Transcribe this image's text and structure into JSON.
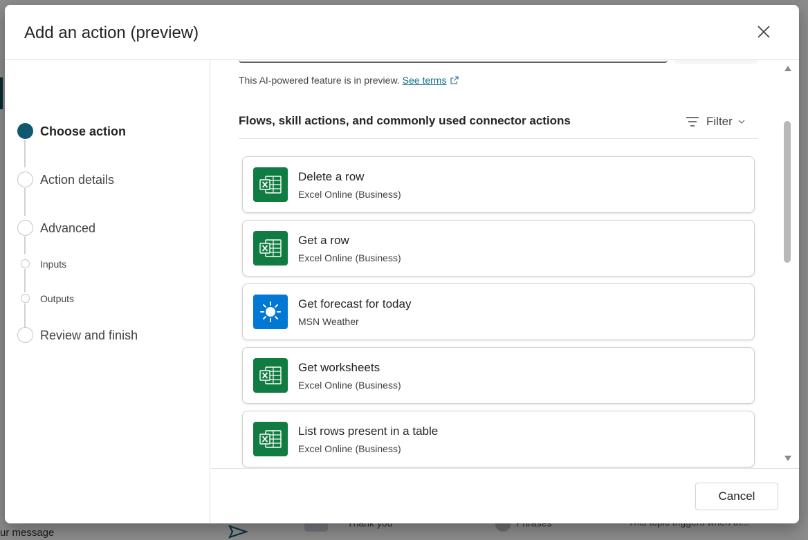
{
  "background": {
    "message_placeholder": "ur message",
    "items": [
      {
        "label": "Thank you"
      },
      {
        "label": "Phrases"
      },
      {
        "label": "This topic triggers when th..."
      }
    ]
  },
  "dialog": {
    "title": "Add an action (preview)",
    "close_icon": "close-icon"
  },
  "steps": {
    "items": [
      {
        "label": "Choose action",
        "state": "active"
      },
      {
        "label": "Action details",
        "state": "pending"
      },
      {
        "label": "Advanced",
        "state": "pending"
      },
      {
        "label": "Inputs",
        "state": "sub"
      },
      {
        "label": "Outputs",
        "state": "sub"
      },
      {
        "label": "Review and finish",
        "state": "pending"
      }
    ]
  },
  "main": {
    "preview_note": "This AI-powered feature is in preview.",
    "see_terms": "See terms",
    "section_title": "Flows, skill actions, and commonly used connector actions",
    "filter_label": "Filter",
    "actions": [
      {
        "title": "Delete a row",
        "connector": "Excel Online (Business)",
        "icon": "excel-icon"
      },
      {
        "title": "Get a row",
        "connector": "Excel Online (Business)",
        "icon": "excel-icon"
      },
      {
        "title": "Get forecast for today",
        "connector": "MSN Weather",
        "icon": "weather-sun-icon"
      },
      {
        "title": "Get worksheets",
        "connector": "Excel Online (Business)",
        "icon": "excel-icon"
      },
      {
        "title": "List rows present in a table",
        "connector": "Excel Online (Business)",
        "icon": "excel-icon"
      }
    ]
  },
  "footer": {
    "cancel_label": "Cancel"
  },
  "colors": {
    "accent": "#0f5870",
    "excel": "#107c41",
    "weather": "#0078d4",
    "link": "#116f8a"
  }
}
